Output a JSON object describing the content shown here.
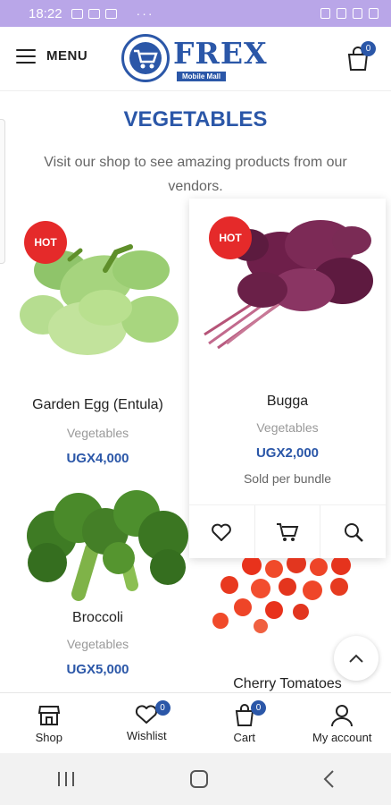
{
  "status_bar": {
    "time": "18:22",
    "dots": "···"
  },
  "header": {
    "menu_label": "MENU",
    "logo_text": "FREX",
    "logo_sub": "Mobile Mall",
    "cart_count": "0"
  },
  "page": {
    "title": "VEGETABLES",
    "description": "Visit our shop to see amazing products from our vendors."
  },
  "products": [
    {
      "name": "Garden Egg (Entula)",
      "category": "Vegetables",
      "price": "UGX4,000",
      "badge": "HOT"
    },
    {
      "name": "Bugga",
      "category": "Vegetables",
      "price": "UGX2,000",
      "badge": "HOT",
      "note": "Sold per bundle"
    },
    {
      "name": "Broccoli",
      "category": "Vegetables",
      "price": "UGX5,000"
    },
    {
      "name": "Cherry Tomatoes"
    }
  ],
  "bottom_nav": [
    {
      "label": "Shop",
      "icon": "store-icon"
    },
    {
      "label": "Wishlist",
      "icon": "heart-icon",
      "count": "0"
    },
    {
      "label": "Cart",
      "icon": "cart-icon",
      "count": "0"
    },
    {
      "label": "My account",
      "icon": "user-icon"
    }
  ],
  "colors": {
    "brand": "#2b57a8",
    "hot": "#e52a2a",
    "status_bar": "#b9a6e8"
  }
}
